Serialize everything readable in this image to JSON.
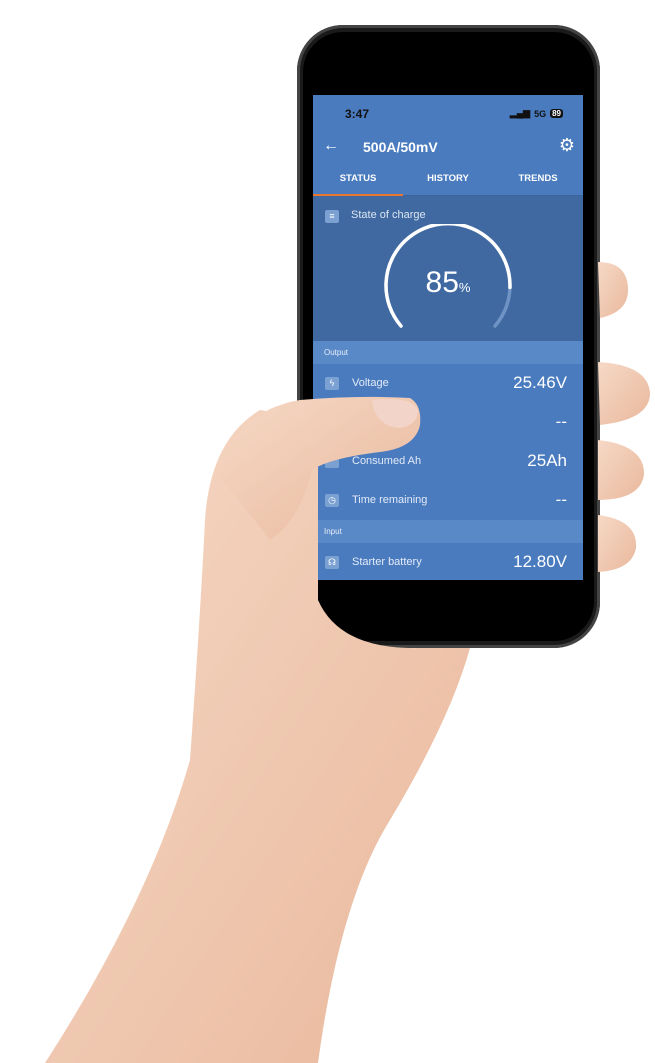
{
  "status_bar": {
    "time": "3:47",
    "network": "5G",
    "battery": "89"
  },
  "header": {
    "title": "500A/50mV",
    "back_icon": "arrow-left-icon",
    "settings_icon": "gear-icon"
  },
  "tabs": [
    {
      "label": "STATUS",
      "active": true
    },
    {
      "label": "HISTORY"
    },
    {
      "label": "TRENDS"
    }
  ],
  "state_of_charge": {
    "label": "State of charge",
    "value": "85",
    "unit": "%",
    "percent": 85
  },
  "output": {
    "title": "Output",
    "rows": [
      {
        "label": "Voltage",
        "value": "25.46V",
        "icon": "bolt-icon"
      },
      {
        "label": "",
        "value": "--",
        "icon": "current-icon"
      },
      {
        "label": "Consumed Ah",
        "value": "25Ah",
        "icon": "battery-icon"
      },
      {
        "label": "Time remaining",
        "value": "--",
        "icon": "clock-icon"
      }
    ]
  },
  "input": {
    "title": "Input",
    "rows": [
      {
        "label": "Starter battery",
        "value": "12.80V",
        "icon": "battery-icon"
      }
    ]
  },
  "colors": {
    "primary": "#4a7bbf",
    "card": "#3f69a0",
    "accent": "#e8762e"
  }
}
